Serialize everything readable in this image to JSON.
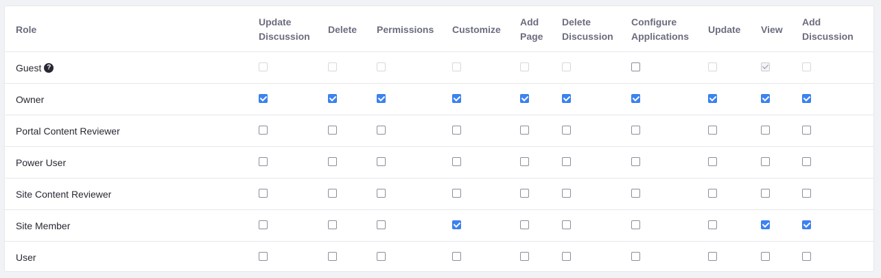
{
  "columns": [
    {
      "key": "role",
      "label": "Role"
    },
    {
      "key": "update_discussion",
      "label": "Update Discussion"
    },
    {
      "key": "delete",
      "label": "Delete"
    },
    {
      "key": "permissions",
      "label": "Permissions"
    },
    {
      "key": "customize",
      "label": "Customize"
    },
    {
      "key": "add_page",
      "label": "Add Page"
    },
    {
      "key": "delete_discussion",
      "label": "Delete Discussion"
    },
    {
      "key": "configure_applications",
      "label": "Configure Applications"
    },
    {
      "key": "update",
      "label": "Update"
    },
    {
      "key": "view",
      "label": "View"
    },
    {
      "key": "add_discussion",
      "label": "Add Discussion"
    }
  ],
  "rows": [
    {
      "role": "Guest",
      "has_help": true,
      "permissions": [
        {
          "checked": false,
          "disabled": true
        },
        {
          "checked": false,
          "disabled": true
        },
        {
          "checked": false,
          "disabled": true
        },
        {
          "checked": false,
          "disabled": true
        },
        {
          "checked": false,
          "disabled": true
        },
        {
          "checked": false,
          "disabled": true
        },
        {
          "checked": false,
          "disabled": false
        },
        {
          "checked": false,
          "disabled": true
        },
        {
          "checked": true,
          "disabled": true
        },
        {
          "checked": false,
          "disabled": true
        }
      ]
    },
    {
      "role": "Owner",
      "has_help": false,
      "permissions": [
        {
          "checked": true,
          "disabled": false
        },
        {
          "checked": true,
          "disabled": false
        },
        {
          "checked": true,
          "disabled": false
        },
        {
          "checked": true,
          "disabled": false
        },
        {
          "checked": true,
          "disabled": false
        },
        {
          "checked": true,
          "disabled": false
        },
        {
          "checked": true,
          "disabled": false
        },
        {
          "checked": true,
          "disabled": false
        },
        {
          "checked": true,
          "disabled": false
        },
        {
          "checked": true,
          "disabled": false
        }
      ]
    },
    {
      "role": "Portal Content Reviewer",
      "has_help": false,
      "permissions": [
        {
          "checked": false,
          "disabled": false
        },
        {
          "checked": false,
          "disabled": false
        },
        {
          "checked": false,
          "disabled": false
        },
        {
          "checked": false,
          "disabled": false
        },
        {
          "checked": false,
          "disabled": false
        },
        {
          "checked": false,
          "disabled": false
        },
        {
          "checked": false,
          "disabled": false
        },
        {
          "checked": false,
          "disabled": false
        },
        {
          "checked": false,
          "disabled": false
        },
        {
          "checked": false,
          "disabled": false
        }
      ]
    },
    {
      "role": "Power User",
      "has_help": false,
      "permissions": [
        {
          "checked": false,
          "disabled": false
        },
        {
          "checked": false,
          "disabled": false
        },
        {
          "checked": false,
          "disabled": false
        },
        {
          "checked": false,
          "disabled": false
        },
        {
          "checked": false,
          "disabled": false
        },
        {
          "checked": false,
          "disabled": false
        },
        {
          "checked": false,
          "disabled": false
        },
        {
          "checked": false,
          "disabled": false
        },
        {
          "checked": false,
          "disabled": false
        },
        {
          "checked": false,
          "disabled": false
        }
      ]
    },
    {
      "role": "Site Content Reviewer",
      "has_help": false,
      "permissions": [
        {
          "checked": false,
          "disabled": false
        },
        {
          "checked": false,
          "disabled": false
        },
        {
          "checked": false,
          "disabled": false
        },
        {
          "checked": false,
          "disabled": false
        },
        {
          "checked": false,
          "disabled": false
        },
        {
          "checked": false,
          "disabled": false
        },
        {
          "checked": false,
          "disabled": false
        },
        {
          "checked": false,
          "disabled": false
        },
        {
          "checked": false,
          "disabled": false
        },
        {
          "checked": false,
          "disabled": false
        }
      ]
    },
    {
      "role": "Site Member",
      "has_help": false,
      "permissions": [
        {
          "checked": false,
          "disabled": false
        },
        {
          "checked": false,
          "disabled": false
        },
        {
          "checked": false,
          "disabled": false
        },
        {
          "checked": true,
          "disabled": false
        },
        {
          "checked": false,
          "disabled": false
        },
        {
          "checked": false,
          "disabled": false
        },
        {
          "checked": false,
          "disabled": false
        },
        {
          "checked": false,
          "disabled": false
        },
        {
          "checked": true,
          "disabled": false
        },
        {
          "checked": true,
          "disabled": false
        }
      ]
    },
    {
      "role": "User",
      "has_help": false,
      "permissions": [
        {
          "checked": false,
          "disabled": false
        },
        {
          "checked": false,
          "disabled": false
        },
        {
          "checked": false,
          "disabled": false
        },
        {
          "checked": false,
          "disabled": false
        },
        {
          "checked": false,
          "disabled": false
        },
        {
          "checked": false,
          "disabled": false
        },
        {
          "checked": false,
          "disabled": false
        },
        {
          "checked": false,
          "disabled": false
        },
        {
          "checked": false,
          "disabled": false
        },
        {
          "checked": false,
          "disabled": false
        }
      ]
    }
  ],
  "help_icon": {
    "name": "question-circle-icon",
    "glyph": "?"
  },
  "colors": {
    "checked": "#3b82f6",
    "header_text": "#6b6c7e",
    "body_text": "#272833",
    "border": "#e7e7ed",
    "background": "#f1f2f5"
  }
}
